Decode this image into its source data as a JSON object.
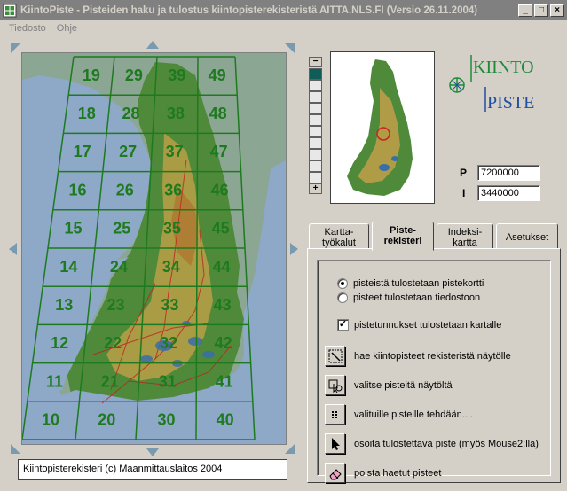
{
  "window": {
    "title": "KiintoPiste - Pisteiden haku ja tulostus kiintopisterekisteristä AITTA.NLS.FI  (Versio 26.11.2004)",
    "minimize": "_",
    "maximize": "□",
    "close": "×"
  },
  "menu": [
    "Tiedosto",
    "Ohje"
  ],
  "map": {
    "grid_labels": [
      "19",
      "29",
      "39",
      "49",
      "18",
      "28",
      "38",
      "48",
      "17",
      "27",
      "37",
      "47",
      "16",
      "26",
      "36",
      "46",
      "15",
      "25",
      "35",
      "45",
      "14",
      "24",
      "34",
      "44",
      "13",
      "23",
      "33",
      "43",
      "12",
      "22",
      "32",
      "42",
      "11",
      "21",
      "31",
      "41",
      "10",
      "20",
      "30",
      "40"
    ],
    "grid_color": "#1e7a1e",
    "water_color": "#8ea8c8"
  },
  "copyright": "Kiintopisterekisteri (c) Maanmittauslaitos 2004",
  "zoom": {
    "plus_label": "+",
    "minus_label": "−"
  },
  "logo": {
    "line1": "KIINTO",
    "line2": "PISTE"
  },
  "coords": {
    "p_label": "P",
    "p_value": "7200000",
    "i_label": "I",
    "i_value": "3440000"
  },
  "tabs": [
    {
      "label": "Kartta-\ntyökalut",
      "selected": false
    },
    {
      "label": "Piste-\nrekisteri",
      "selected": true
    },
    {
      "label": "Indeksi-\nkartta",
      "selected": false
    },
    {
      "label": "Asetukset",
      "selected": false
    }
  ],
  "panel": {
    "radio1": "pisteistä tulostetaan pistekortti",
    "radio2": "pisteet tulostetaan tiedostoon",
    "checkbox": "pistetunnukset tulostetaan kartalle",
    "tool1": "hae kiintopisteet rekisteristä näytölle",
    "tool2": "valitse pisteitä näytöltä",
    "tool3": "valituille pisteille tehdään....",
    "tool4": "osoita tulostettava piste (myös Mouse2:lla)",
    "tool5": "poista haetut pisteet"
  },
  "colors": {
    "accent_green": "#0e5d58",
    "logo_green": "#1e8a3a",
    "logo_blue": "#1f4fa0"
  }
}
